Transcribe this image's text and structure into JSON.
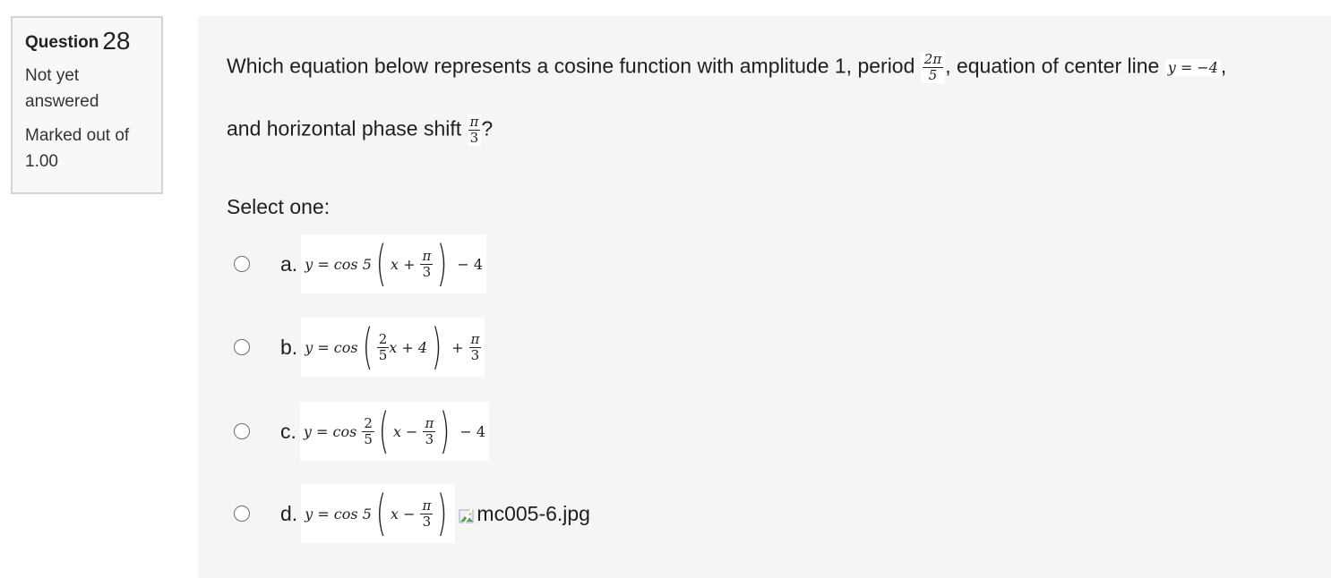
{
  "info": {
    "question_label": "Question",
    "question_number": "28",
    "state": "Not yet answered",
    "state_line1": "Not yet",
    "state_line2": "answered",
    "marked_line1": "Marked out of",
    "marked_line2": "1.00"
  },
  "question": {
    "part1": "Which equation below represents a cosine function with amplitude 1, period",
    "period_num": "2π",
    "period_den": "5",
    "part2": ", equation of center line",
    "center_line": "y = −4",
    "part3": ",",
    "part4": "and horizontal phase shift",
    "shift_num": "π",
    "shift_den": "3",
    "part5": "?"
  },
  "select_label": "Select one:",
  "options": [
    {
      "letter": "a.",
      "lhs": "y = cos 5",
      "inner_var": "x +",
      "frac_num": "π",
      "frac_den": "3",
      "tail": "− 4"
    },
    {
      "letter": "b.",
      "lhs": "y = cos",
      "frac_num": "2",
      "frac_den": "5",
      "inner": "x + 4",
      "tail": "+",
      "tail_num": "π",
      "tail_den": "3"
    },
    {
      "letter": "c.",
      "lhs": "y = cos",
      "coef_num": "2",
      "coef_den": "5",
      "inner_var": "x −",
      "frac_num": "π",
      "frac_den": "3",
      "tail": "− 4"
    },
    {
      "letter": "d.",
      "lhs": "y = cos 5",
      "inner_var": "x −",
      "frac_num": "π",
      "frac_den": "3",
      "broken_image_alt": "mc005-6.jpg"
    }
  ],
  "colors": {
    "content_bg": "#f5f5f5",
    "info_bg": "#f8f8f8",
    "info_border": "#d4d4d4"
  }
}
